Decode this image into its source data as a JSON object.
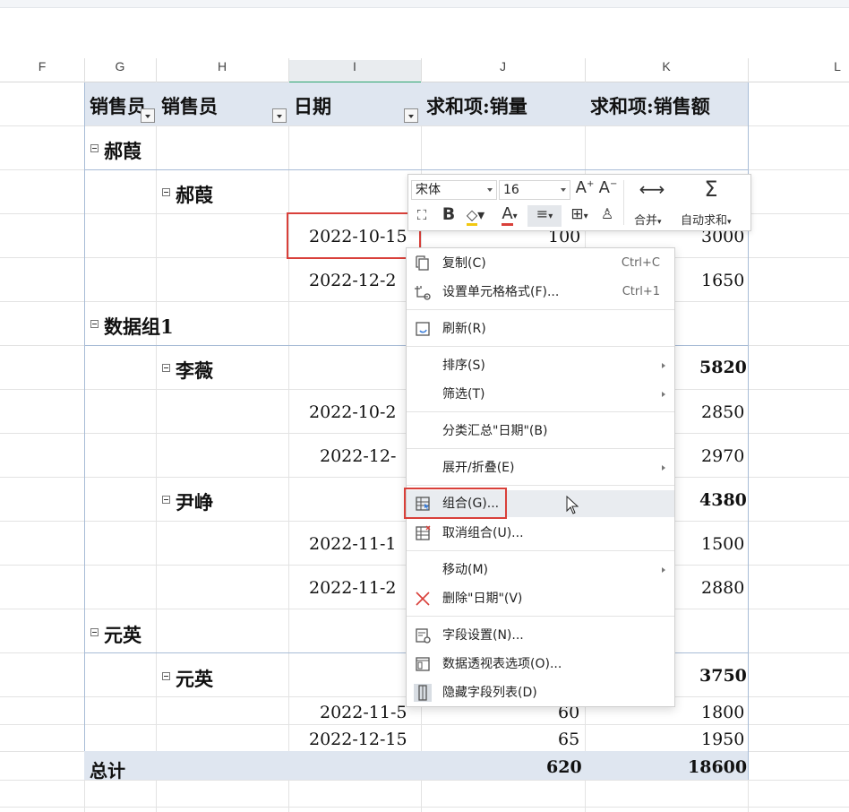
{
  "columns": {
    "letters": [
      "F",
      "G",
      "H",
      "I",
      "J",
      "K",
      "L"
    ]
  },
  "pivot": {
    "headers": [
      "销售员",
      "销售员",
      "日期",
      "求和项:销量",
      "求和项:销售额"
    ],
    "rows": {
      "g1": "郝葭",
      "g1_sub": "郝葭",
      "g1_d1": "2022-10-15",
      "g1_d1_qty": "100",
      "g1_d1_amt": "3000",
      "g1_d2": "2022-12-2",
      "g1_d2_amt": "1650",
      "g2": "数据组1",
      "g2_s1": "李薇",
      "g2_s1_total": "5820",
      "g2_s1_d1": "2022-10-2",
      "g2_s1_d1_amt": "2850",
      "g2_s1_d2": "2022-12-",
      "g2_s1_d2_amt": "2970",
      "g2_s2": "尹峥",
      "g2_s2_total": "4380",
      "g2_s2_d1": "2022-11-1",
      "g2_s2_d1_amt": "1500",
      "g2_s2_d2": "2022-11-2",
      "g2_s2_d2_amt": "2880",
      "g3": "元英",
      "g3_sub": "元英",
      "g3_sub_total": "3750",
      "g3_d1": "2022-11-5",
      "g3_d1_qty": "60",
      "g3_d1_amt": "1800",
      "g3_d2": "2022-12-15",
      "g3_d2_qty": "65",
      "g3_d2_amt": "1950"
    },
    "total": {
      "label": "总计",
      "qty": "620",
      "amt": "18600"
    }
  },
  "toolbar": {
    "font_name": "宋体",
    "font_size": "16",
    "merge_label": "合并",
    "autosum_label": "自动求和"
  },
  "menu": {
    "items": [
      {
        "label": "复制(C)",
        "shortcut": "Ctrl+C"
      },
      {
        "label": "设置单元格格式(F)...",
        "shortcut": "Ctrl+1"
      },
      {
        "label": "刷新(R)"
      },
      {
        "label": "排序(S)"
      },
      {
        "label": "筛选(T)"
      },
      {
        "label": "分类汇总\"日期\"(B)"
      },
      {
        "label": "展开/折叠(E)"
      },
      {
        "label": "组合(G)..."
      },
      {
        "label": "取消组合(U)..."
      },
      {
        "label": "移动(M)"
      },
      {
        "label": "删除\"日期\"(V)"
      },
      {
        "label": "字段设置(N)..."
      },
      {
        "label": "数据透视表选项(O)..."
      },
      {
        "label": "隐藏字段列表(D)"
      }
    ]
  },
  "colors": {
    "pivot_header": "#dfe6f0",
    "highlight_box": "#d9403a",
    "selected_column": "#2aa56f"
  }
}
